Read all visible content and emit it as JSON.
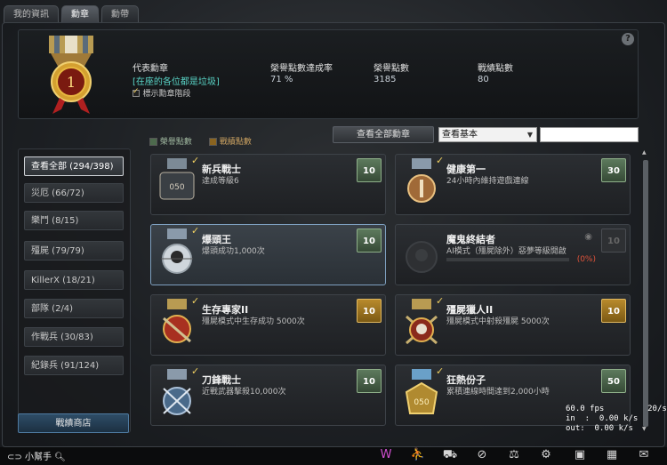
{
  "tabs": [
    "我的資訊",
    "勳章",
    "勳帶"
  ],
  "active_tab": 1,
  "header": {
    "medal_number": "1",
    "featured_label": "代表勳章",
    "featured_name": "[在座的各位都是垃圾]",
    "show_stage_label": "標示勳章階段",
    "stats": [
      {
        "label": "榮譽點數達成率",
        "value": "71 %"
      },
      {
        "label": "榮譽點數",
        "value": "3185"
      },
      {
        "label": "戰績點數",
        "value": "80"
      }
    ],
    "help": "?"
  },
  "legend": {
    "honor": "榮譽點數",
    "combat": "戰績點數"
  },
  "controls": {
    "view_all": "查看全部勳章",
    "filter_value": "查看基本"
  },
  "sidebar": {
    "categories": [
      "查看全部 (294/398)",
      "災厄 (66/72)",
      "樂鬥 (8/15)",
      "殭屍 (79/79)",
      "KillerX (18/21)",
      "部隊 (2/4)",
      "作戰兵 (30/83)",
      "紀錄兵 (91/124)"
    ],
    "shop_button": "戰績商店"
  },
  "cards": [
    {
      "title": "新兵戰士",
      "desc": "達成等級6",
      "points": "10",
      "tier": "green",
      "done": true
    },
    {
      "title": "健康第一",
      "desc": "24小時內維持遊戲連線",
      "points": "30",
      "tier": "green",
      "done": true
    },
    {
      "title": "爆頭王",
      "desc": "爆頭成功1,000次",
      "points": "10",
      "tier": "green",
      "done": true
    },
    {
      "title": "魔鬼終結者",
      "desc": "AI模式（殭屍除外）惡夢等級開啟",
      "points": "10",
      "tier": "grey",
      "done": false,
      "progress": "(0%)"
    },
    {
      "title": "生存專家II",
      "desc": "殭屍模式中生存成功 5000次",
      "points": "10",
      "tier": "gold",
      "done": true
    },
    {
      "title": "殭屍獵人II",
      "desc": "殭屍模式中射殺殭屍 5000次",
      "points": "10",
      "tier": "gold",
      "done": true
    },
    {
      "title": "刀鋒戰士",
      "desc": "近戰武器擊殺10,000次",
      "points": "10",
      "tier": "green",
      "done": true
    },
    {
      "title": "狂熱份子",
      "desc": "累積連線時間達到2,000小時",
      "points": "50",
      "tier": "green",
      "done": true
    }
  ],
  "footer": {
    "helper": "小幫手"
  },
  "overlay": {
    "fps": "60.0 fps",
    "frac": "20/s",
    "in": "in  :  0.00 k/s",
    "out": "out:  0.00 k/s"
  },
  "colors": {
    "accent_teal": "#5ad6c8",
    "check_gold": "#f0d060",
    "progress_red": "#e0533a"
  }
}
